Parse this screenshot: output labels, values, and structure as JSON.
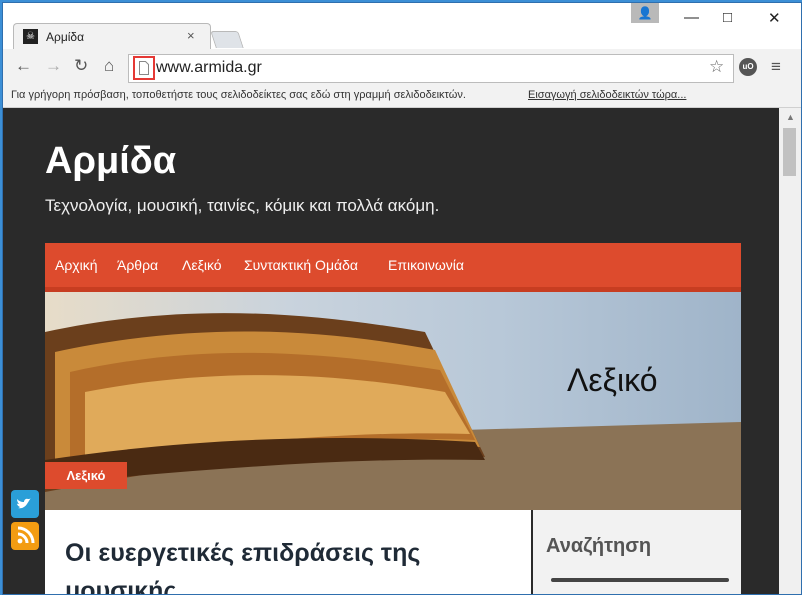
{
  "browser": {
    "tab_title": "Αρμίδα",
    "url": "www.armida.gr",
    "bookmarks_text": "Για γρήγορη πρόσβαση, τοποθετήστε τους σελιδοδείκτες σας εδώ στη γραμμή σελιδοδεικτών.",
    "bookmarks_link": "Εισαγωγή σελιδοδεικτών τώρα..."
  },
  "site": {
    "title": "Αρμίδα",
    "tagline": "Τεχνολογία, μουσική, ταινίες, κόμικ και πολλά ακόμη.",
    "nav": [
      "Αρχική",
      "Άρθρα",
      "Λεξικό",
      "Συντακτική Ομάδα",
      "Επικοινωνία"
    ],
    "hero_text": "Λεξικό",
    "hero_badge": "Λεξικό",
    "article_title": "Οι ευεργετικές επιδράσεις της μουσικής",
    "sidebar_title": "Αναζήτηση"
  },
  "icons": {
    "back": "arrow-left-icon",
    "forward": "arrow-right-icon",
    "reload": "reload-icon",
    "home": "home-icon",
    "page": "page-icon",
    "star": "star-icon",
    "extension": "ublock-icon",
    "menu": "menu-icon"
  },
  "colors": {
    "accent": "#dd4b2d",
    "page_background": "#2a2a2a",
    "twitter": "#2a9fd8",
    "rss": "#f39c12"
  }
}
